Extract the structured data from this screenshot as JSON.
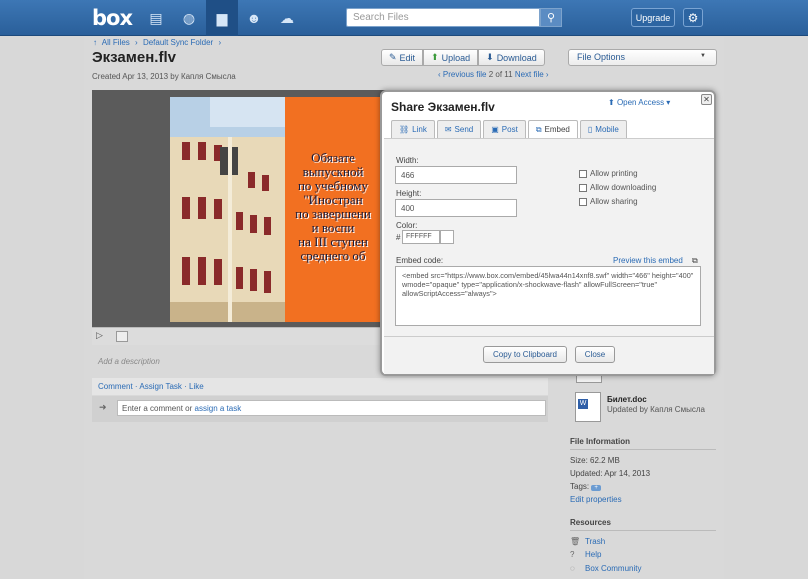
{
  "colors": {
    "topbar": "#3471b0",
    "link": "#2a6bb5",
    "video_bg": "#f27021"
  },
  "header": {
    "logo": "box",
    "nav_icons": [
      "updates-icon",
      "globe-icon",
      "folder-icon",
      "users-icon",
      "cloud-icon"
    ],
    "search_placeholder": "Search Files",
    "upgrade_label": "Upgrade",
    "settings_icon": "gear-icon"
  },
  "breadcrumb": {
    "items": [
      "All Files",
      "Default Sync Folder"
    ]
  },
  "file": {
    "title": "Экзамен.flv",
    "created": "Created Apr 13, 2013 by Капля Смысла"
  },
  "toolbar": {
    "edit": "Edit",
    "upload": "Upload",
    "download": "Download",
    "file_options": "File Options"
  },
  "pager": {
    "prev": "‹ Previous file",
    "position": "2 of 11",
    "next": "Next file ›"
  },
  "video": {
    "text_lines": [
      "Обязате",
      "выпускной",
      "по учебному",
      "\"Иностран",
      "по завершени",
      "и воспи",
      "на III ступен",
      "среднего об"
    ]
  },
  "comments": {
    "description_placeholder": "Add a description",
    "actions": [
      "Comment",
      "Assign Task",
      "Like"
    ],
    "input_prefix": "Enter a comment",
    "input_or": "or",
    "input_link": "assign a task"
  },
  "sidebar": {
    "related_file_name": "Билет.doc",
    "related_file_sub": "Updated by Капля Смысла",
    "file_info_heading": "File Information",
    "size": "Size: 62.2 MB",
    "updated": "Updated: Apr 14, 2013",
    "tags_label": "Tags:",
    "tag_badge": "+",
    "edit_properties": "Edit properties",
    "resources_heading": "Resources",
    "resources": [
      "Trash",
      "Help",
      "Box Community"
    ]
  },
  "modal": {
    "title": "Share Экзамен.flv",
    "open_access": "Open Access",
    "close_glyph": "✕",
    "tabs": [
      "Link",
      "Send",
      "Post",
      "Embed",
      "Mobile"
    ],
    "active_tab": "Embed",
    "width_label": "Width:",
    "width_value": "466",
    "height_label": "Height:",
    "height_value": "400",
    "color_label": "Color:",
    "color_hash": "#",
    "color_value": "FFFFFF",
    "checkboxes": [
      "Allow printing",
      "Allow downloading",
      "Allow sharing"
    ],
    "embed_label": "Embed code:",
    "preview_link": "Preview this embed",
    "embed_code": "<embed src=\"https://www.box.com/embed/45lwa44n14xnf8.swf\" width=\"466\" height=\"400\" wmode=\"opaque\" type=\"application/x-shockwave-flash\" allowFullScreen=\"true\" allowScriptAccess=\"always\">",
    "copy_button": "Copy to Clipboard",
    "close_button": "Close"
  }
}
